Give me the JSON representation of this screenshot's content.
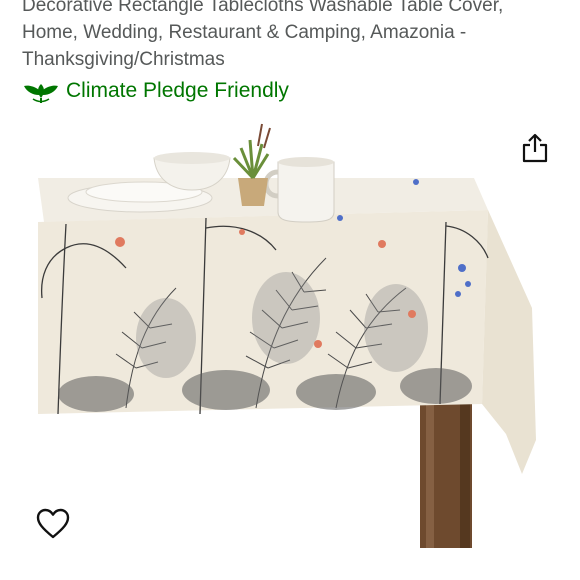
{
  "product": {
    "title_lines": [
      "Decorative Rectangle Tablecloths Washable Table Cover,",
      "Home, Wedding, Restaurant & Camping, Amazonia -",
      "Thanksgiving/Christmas"
    ]
  },
  "badge": {
    "label": "Climate Pledge Friendly",
    "icon": "climate-pledge-leaf-icon",
    "color": "#007600"
  },
  "actions": {
    "share_icon": "share-icon",
    "wishlist_icon": "heart-outline-icon"
  },
  "image": {
    "subject": "tropical-botanical-tablecloth"
  }
}
